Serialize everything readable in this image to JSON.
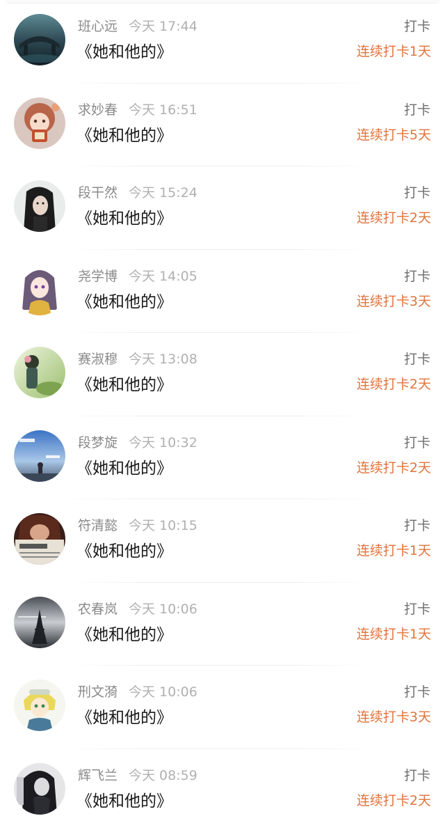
{
  "list": {
    "items": [
      {
        "name": "班心远",
        "time": "今天 17:44",
        "book": "《她和他的》",
        "action": "打卡",
        "streak": "连续打卡1天",
        "avatar": "dark-bridge-avatar"
      },
      {
        "name": "求妙春",
        "time": "今天 16:51",
        "book": "《她和他的》",
        "action": "打卡",
        "streak": "连续打卡5天",
        "avatar": "anime-girl-avatar"
      },
      {
        "name": "段干然",
        "time": "今天 15:24",
        "book": "《她和他的》",
        "action": "打卡",
        "streak": "连续打卡2天",
        "avatar": "woman-portrait-avatar"
      },
      {
        "name": "尧学博",
        "time": "今天 14:05",
        "book": "《她和他的》",
        "action": "打卡",
        "streak": "连续打卡3天",
        "avatar": "purple-anime-avatar"
      },
      {
        "name": "赛淑穆",
        "time": "今天 13:08",
        "book": "《她和他的》",
        "action": "打卡",
        "streak": "连续打卡2天",
        "avatar": "girl-garden-avatar"
      },
      {
        "name": "段梦旋",
        "time": "今天 10:32",
        "book": "《她和他的》",
        "action": "打卡",
        "streak": "连续打卡2天",
        "avatar": "blue-sky-avatar"
      },
      {
        "name": "符清懿",
        "time": "今天 10:15",
        "book": "《她和他的》",
        "action": "打卡",
        "streak": "连续打卡1天",
        "avatar": "newspaper-avatar"
      },
      {
        "name": "农春岚",
        "time": "今天 10:06",
        "book": "《她和他的》",
        "action": "打卡",
        "streak": "连续打卡1天",
        "avatar": "eiffel-tower-avatar"
      },
      {
        "name": "刑文漪",
        "time": "今天 10:06",
        "book": "《她和他的》",
        "action": "打卡",
        "streak": "连续打卡3天",
        "avatar": "yellow-anime-avatar"
      },
      {
        "name": "辉飞兰",
        "time": "今天 08:59",
        "book": "《她和他的》",
        "action": "打卡",
        "streak": "连续打卡2天",
        "avatar": "dark-girl-avatar"
      }
    ]
  },
  "colors": {
    "streak": "#e0743c",
    "name": "#8a8a8a",
    "book": "#1a1a1a"
  }
}
